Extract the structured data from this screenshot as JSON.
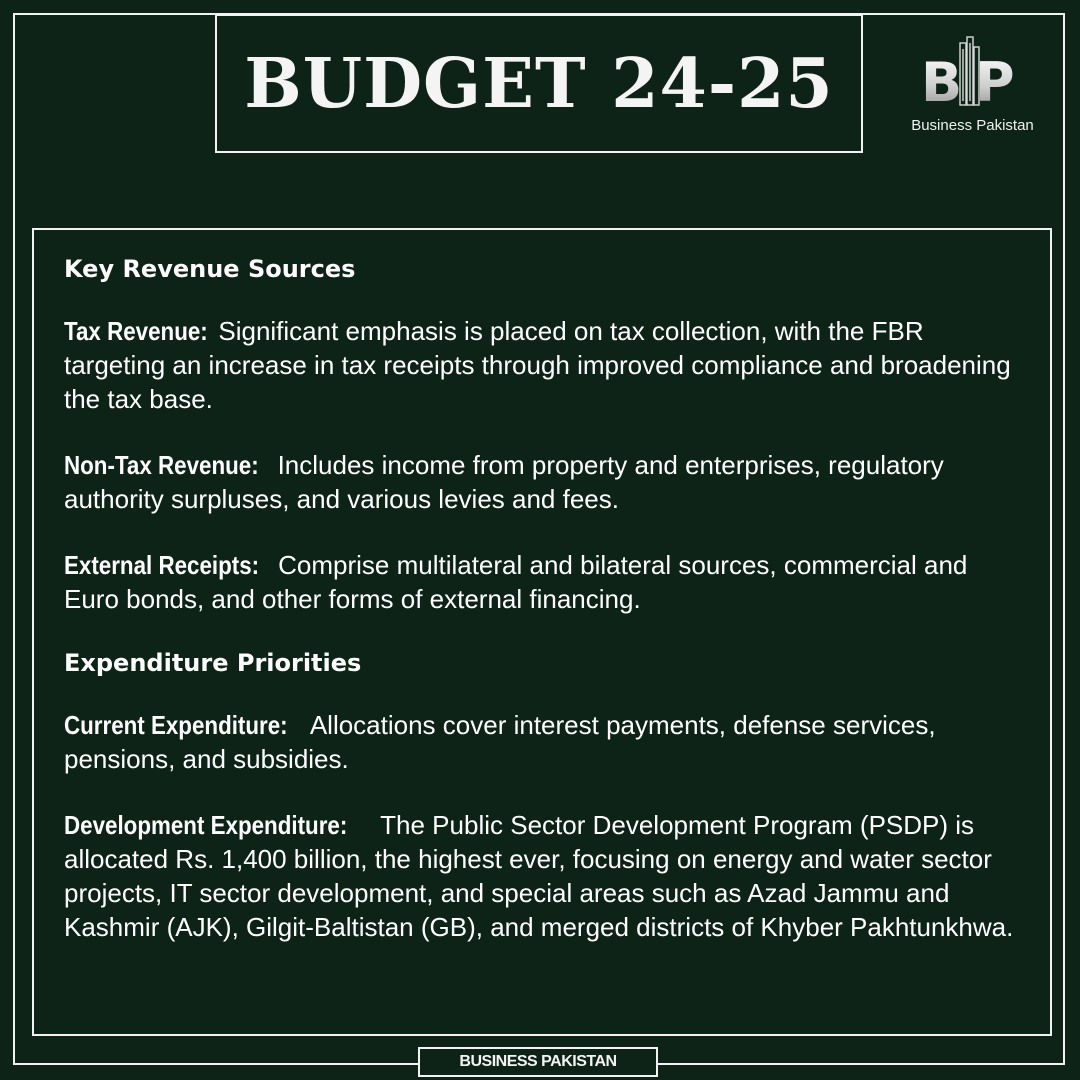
{
  "header": {
    "title": "BUDGET 24-25",
    "logo_mark": "BP",
    "logo_caption": "Business Pakistan"
  },
  "sections": [
    {
      "heading": "Key Revenue Sources",
      "items": [
        {
          "label": "Tax Revenue:",
          "text": " Significant emphasis is placed on tax  collection, with the FBR targeting an increase in tax receipts through improved compliance and  broadening the tax base."
        },
        {
          "label": "Non-Tax Revenue:",
          "text": " Includes income from property and enterprises, regulatory authority surpluses, and various levies and fees."
        },
        {
          "label": "External Receipts:",
          "text": " Comprise multilateral and bilateral sources, commercial and Euro bonds, and other forms of external financing."
        }
      ]
    },
    {
      "heading": "Expenditure Priorities",
      "items": [
        {
          "label": "Current Expenditure:",
          "text": " Allocations cover interest payments, defense services, pensions, and subsidies."
        },
        {
          "label": "Development Expenditure:",
          "text": " The Public Sector Development Program (PSDP) is allocated Rs. 1,400 billion, the highest ever, focusing on energy and water sector projects, IT sector development, and special areas such as Azad Jammu and Kashmir (AJK), Gilgit-Baltistan (GB), and merged districts of Khyber Pakhtunkhwa."
        }
      ]
    }
  ],
  "footer": {
    "label": "BUSINESS PAKISTAN"
  },
  "colors": {
    "background": "#0e2317",
    "frame": "#f2f2f2",
    "text": "#ffffff"
  }
}
